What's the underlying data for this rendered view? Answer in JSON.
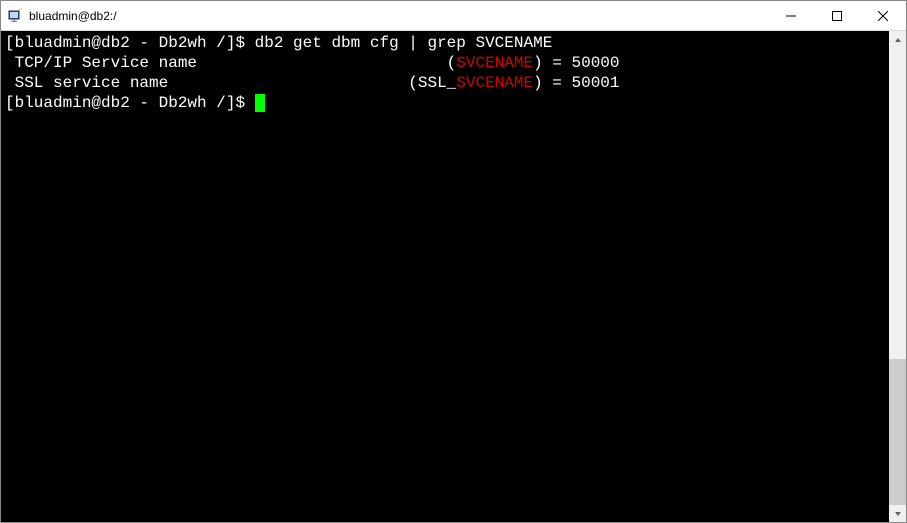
{
  "window": {
    "title": "bluadmin@db2:/"
  },
  "terminal": {
    "line1_prompt": "[bluadmin@db2 - Db2wh /]$ ",
    "line1_cmd": "db2 get dbm cfg | grep SVCENAME",
    "line2_label": " TCP/IP Service name",
    "line2_pad": "                          (",
    "line2_hl": "SVCENAME",
    "line2_rest": ") = 50000",
    "line3_label": " SSL service name",
    "line3_pad": "                         (SSL_",
    "line3_hl": "SVCENAME",
    "line3_rest": ") = 50001",
    "line4_prompt": "[bluadmin@db2 - Db2wh /]$ "
  },
  "scrollbar": {
    "thumb_top_pct": "68",
    "thumb_height_pct": "32"
  }
}
